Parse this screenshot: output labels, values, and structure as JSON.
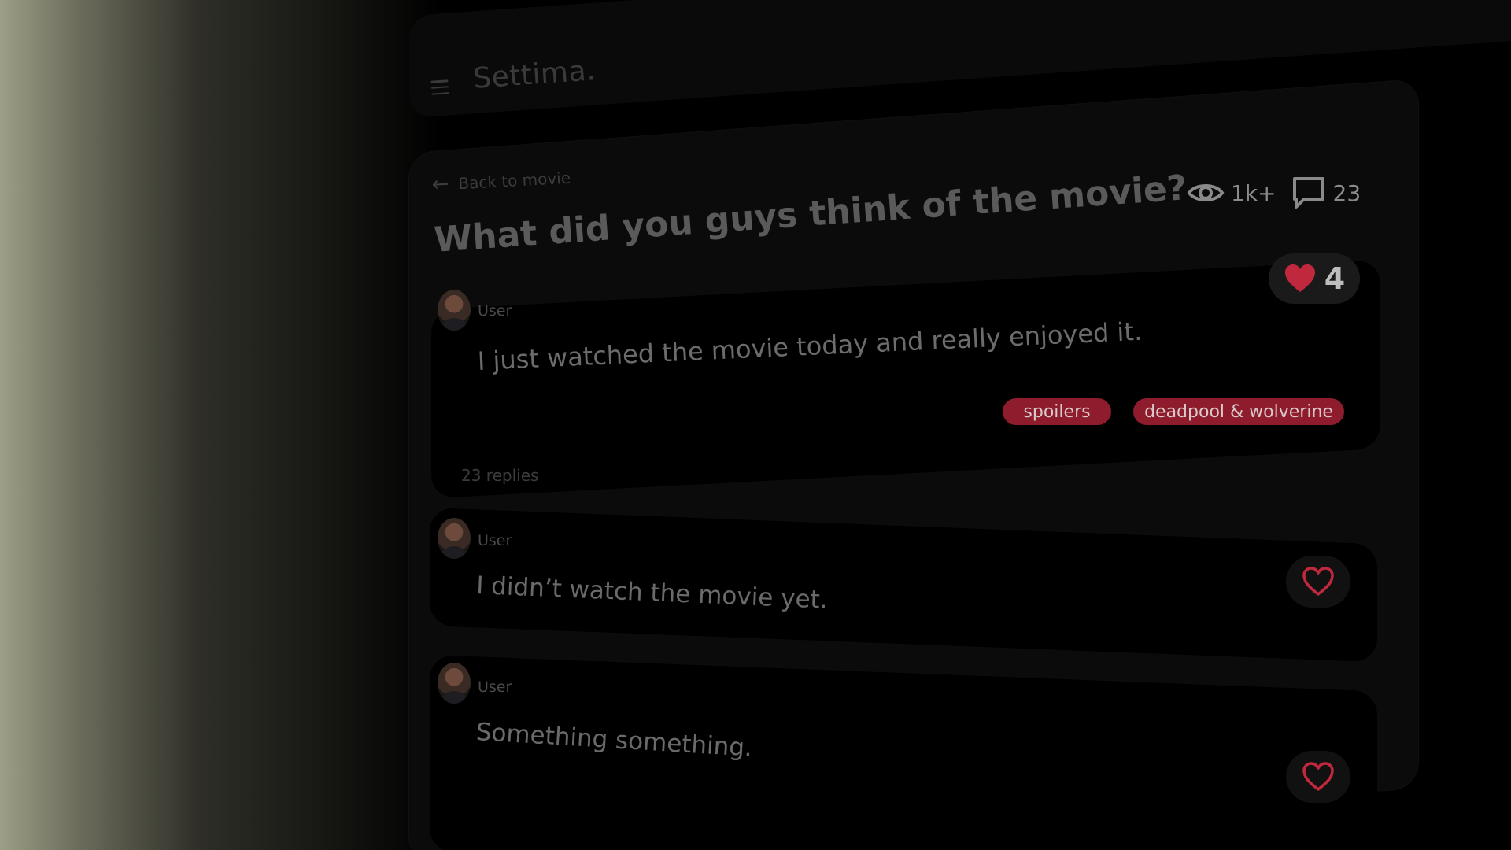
{
  "app": {
    "brand": "Settima."
  },
  "nav": {
    "back_label": "Back to movie"
  },
  "thread": {
    "title": "What did you guys think of the movie?",
    "views": "1k+",
    "comments": "23"
  },
  "post": {
    "user": "User",
    "text": "I just watched the movie today and really enjoyed it.",
    "likes": "4",
    "tags": [
      "spoilers",
      "deadpool & wolverine"
    ]
  },
  "replies_label": "23 replies",
  "replies": [
    {
      "user": "User",
      "text": "I didn’t watch the movie yet."
    },
    {
      "user": "User",
      "text": "Something something."
    }
  ],
  "colors": {
    "accent": "#8e1c2c",
    "heart": "#c0283e",
    "background": "#000000",
    "panel": "#0b0b0b"
  },
  "icons": {
    "menu": "hamburger-icon",
    "back": "arrow-left-icon",
    "views": "eye-icon",
    "comments": "speech-bubble-icon",
    "like_filled": "heart-filled-icon",
    "like_outline": "heart-outline-icon"
  }
}
